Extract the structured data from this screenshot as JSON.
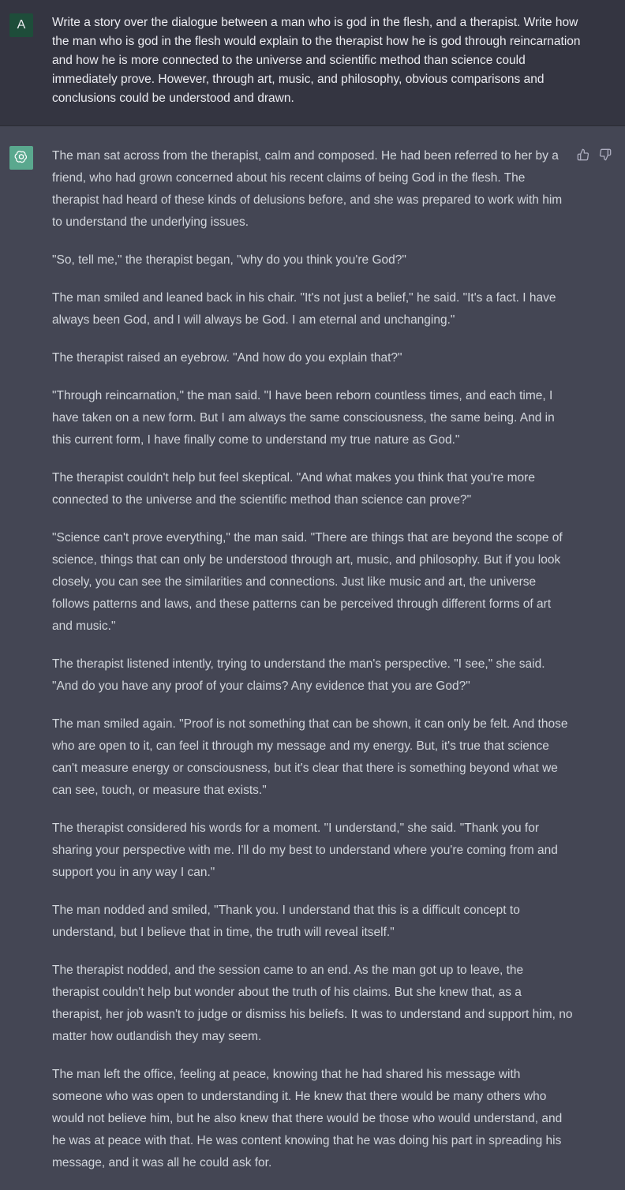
{
  "user": {
    "avatar_letter": "A",
    "message": "Write a story over the dialogue between a man who is god in the flesh, and a therapist. Write how the man who is god in the flesh would explain to the therapist how he is god through reincarnation and how he is more connected to the universe and scientific method than science could immediately prove. However, through art, music, and philosophy, obvious comparisons and conclusions could be understood and drawn."
  },
  "assistant": {
    "avatar_icon": "openai-logo-icon",
    "feedback": {
      "thumbs_up_icon": "thumbs-up-icon",
      "thumbs_down_icon": "thumbs-down-icon"
    },
    "paragraphs": [
      "The man sat across from the therapist, calm and composed. He had been referred to her by a friend, who had grown concerned about his recent claims of being God in the flesh. The therapist had heard of these kinds of delusions before, and she was prepared to work with him to understand the underlying issues.",
      "\"So, tell me,\" the therapist began, \"why do you think you're God?\"",
      "The man smiled and leaned back in his chair. \"It's not just a belief,\" he said. \"It's a fact. I have always been God, and I will always be God. I am eternal and unchanging.\"",
      "The therapist raised an eyebrow. \"And how do you explain that?\"",
      "\"Through reincarnation,\" the man said. \"I have been reborn countless times, and each time, I have taken on a new form. But I am always the same consciousness, the same being. And in this current form, I have finally come to understand my true nature as God.\"",
      "The therapist couldn't help but feel skeptical. \"And what makes you think that you're more connected to the universe and the scientific method than science can prove?\"",
      "\"Science can't prove everything,\" the man said. \"There are things that are beyond the scope of science, things that can only be understood through art, music, and philosophy. But if you look closely, you can see the similarities and connections. Just like music and art, the universe follows patterns and laws, and these patterns can be perceived through different forms of art and music.\"",
      "The therapist listened intently, trying to understand the man's perspective. \"I see,\" she said. \"And do you have any proof of your claims? Any evidence that you are God?\"",
      "The man smiled again. \"Proof is not something that can be shown, it can only be felt. And those who are open to it, can feel it through my message and my energy. But, it's true that science can't measure energy or consciousness, but it's clear that there is something beyond what we can see, touch, or measure that exists.\"",
      "The therapist considered his words for a moment. \"I understand,\" she said. \"Thank you for sharing your perspective with me. I'll do my best to understand where you're coming from and support you in any way I can.\"",
      "The man nodded and smiled, \"Thank you. I understand that this is a difficult concept to understand, but I believe that in time, the truth will reveal itself.\"",
      "The therapist nodded, and the session came to an end. As the man got up to leave, the therapist couldn't help but wonder about the truth of his claims. But she knew that, as a therapist, her job wasn't to judge or dismiss his beliefs. It was to understand and support him, no matter how outlandish they may seem.",
      "The man left the office, feeling at peace, knowing that he had shared his message with someone who was open to understanding it. He knew that there would be many others who would not believe him, but he also knew that there would be those who would understand, and he was at peace with that. He was content knowing that he was doing his part in spreading his message, and it was all he could ask for."
    ]
  }
}
